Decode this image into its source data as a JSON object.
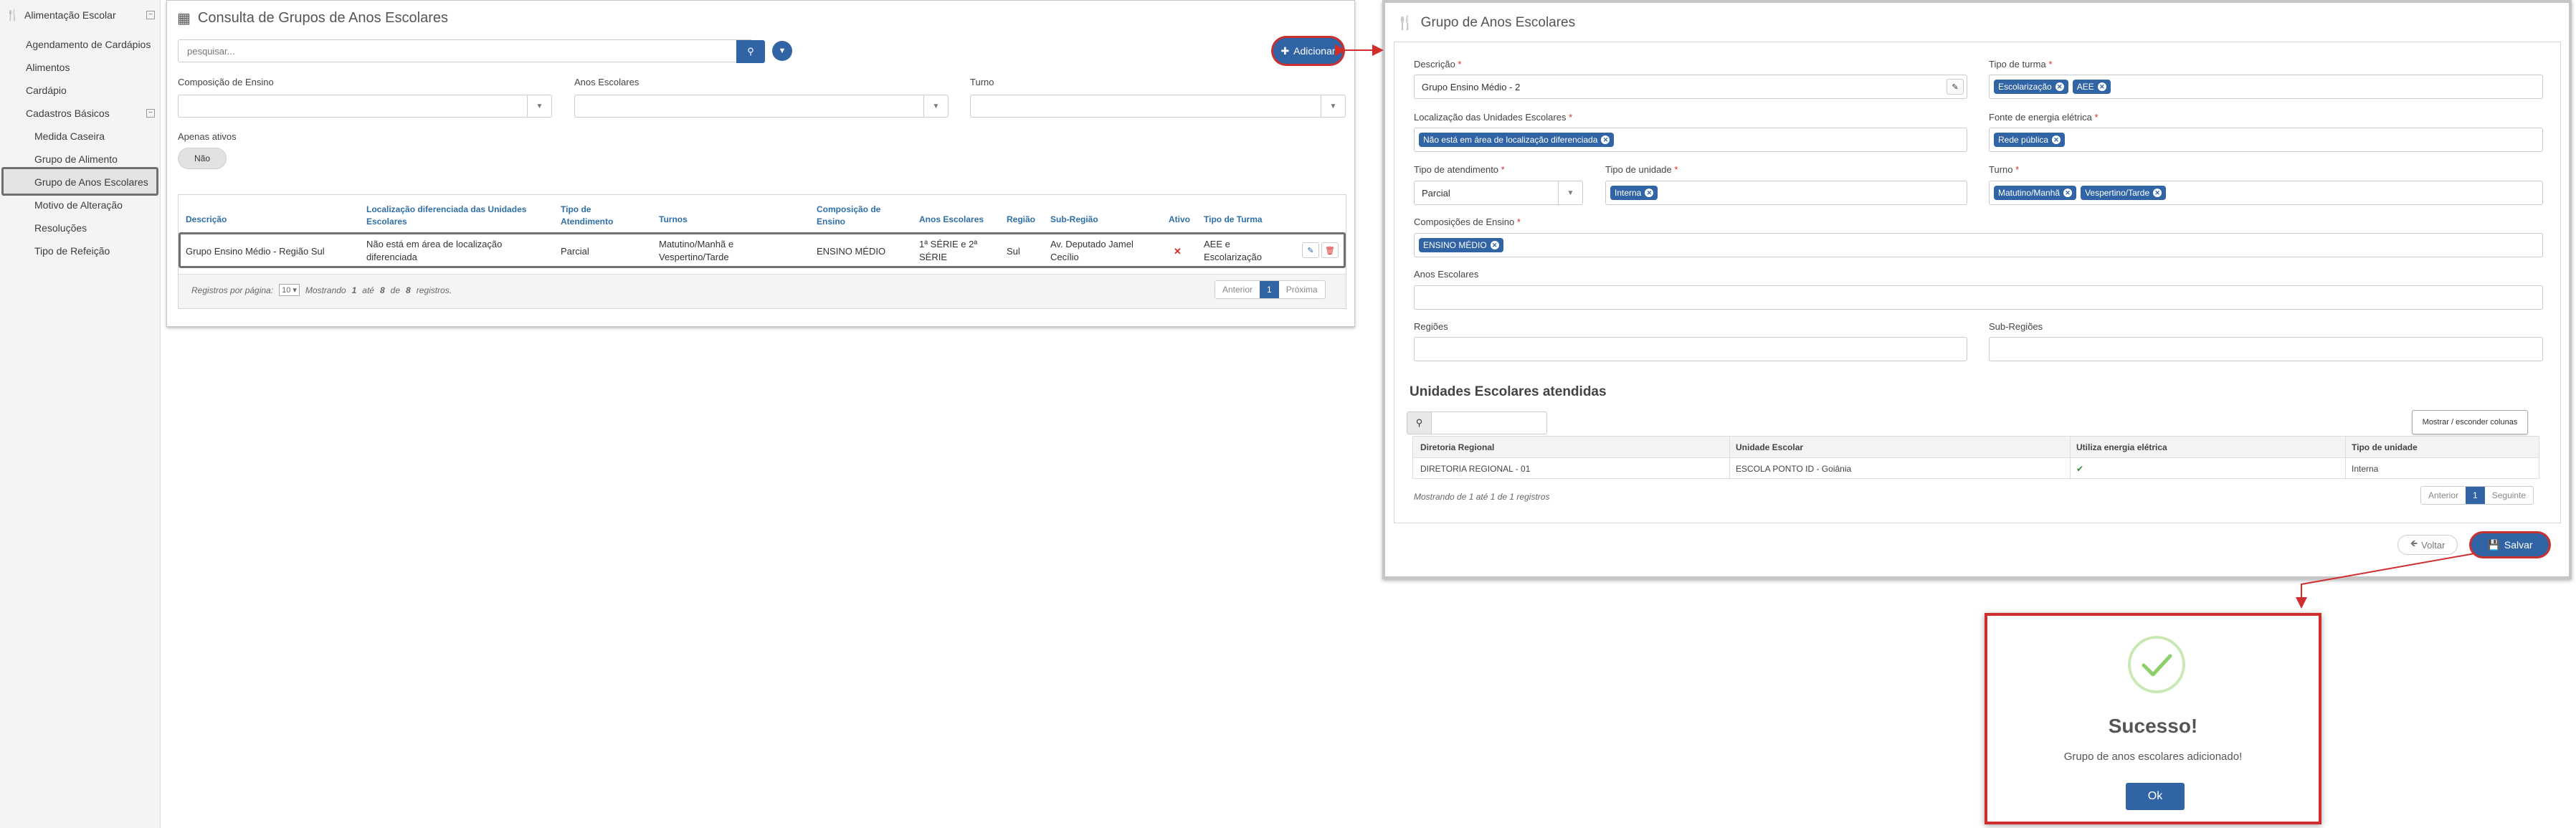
{
  "sidebar": {
    "title": "Alimentação Escolar",
    "items": [
      "Agendamento de Cardápios",
      "Alimentos",
      "Cardápio"
    ],
    "group": "Cadastros Básicos",
    "subitems": [
      "Medida Caseira",
      "Grupo de Alimento",
      "Grupo de Anos Escolares",
      "Motivo de Alteração",
      "Resoluções",
      "Tipo de Refeição"
    ]
  },
  "list_panel": {
    "title": "Consulta de Grupos de Anos Escolares",
    "search_placeholder": "pesquisar...",
    "add_label": "Adicionar",
    "filters": {
      "composicao": "Composição de Ensino",
      "anos": "Anos Escolares",
      "turno": "Turno",
      "apenas_ativos": "Apenas ativos",
      "apenas_ativos_value": "Não"
    },
    "columns": [
      "Descrição",
      "Localização diferenciada das Unidades Escolares",
      "Tipo de Atendimento",
      "Turnos",
      "Composição de Ensino",
      "Anos Escolares",
      "Região",
      "Sub-Região",
      "Ativo",
      "Tipo de Turma"
    ],
    "row": [
      "Grupo Ensino Médio - Região Sul",
      "Não está em área de localização diferenciada",
      "Parcial",
      "Matutino/Manhã e Vespertino/Tarde",
      "ENSINO MÉDIO",
      "1ª SÉRIE e 2ª SÉRIE",
      "Sul",
      "Av. Deputado Jamel Cecílio",
      "✕",
      "AEE e Escolarização"
    ],
    "footer": {
      "per_page_label": "Registros por página:",
      "per_page": "10",
      "showing_pre": "Mostrando",
      "from": "1",
      "until": "até",
      "to": "8",
      "of": "de",
      "total": "8",
      "suffix": "registros."
    },
    "pager": {
      "prev": "Anterior",
      "page": "1",
      "next": "Próxima"
    }
  },
  "form_panel": {
    "title": "Grupo de Anos Escolares",
    "descricao_label": "Descrição",
    "descricao": "Grupo Ensino Médio - 2",
    "tipo_turma_label": "Tipo de turma",
    "tipo_turma": [
      "Escolarização",
      "AEE"
    ],
    "localizacao_label": "Localização das Unidades Escolares",
    "localizacao": [
      "Não está em área de localização diferenciada"
    ],
    "fonte_label": "Fonte de energia elétrica",
    "fonte": [
      "Rede pública"
    ],
    "atendimento_label": "Tipo de atendimento",
    "atendimento": "Parcial",
    "tipo_unidade_label": "Tipo de unidade",
    "tipo_unidade": [
      "Interna"
    ],
    "turno_label": "Turno",
    "turno": [
      "Matutino/Manhã",
      "Vespertino/Tarde"
    ],
    "composicoes_label": "Composições de Ensino",
    "composicoes": [
      "ENSINO MÉDIO"
    ],
    "anos_label": "Anos Escolares",
    "regioes_label": "Regiões",
    "subregioes_label": "Sub-Regiões",
    "section_title": "Unidades Escolares atendidas",
    "cols_button": "Mostrar / esconder colunas",
    "table_headers": [
      "Diretoria Regional",
      "Unidade Escolar",
      "Utiliza energia elétrica",
      "Tipo de unidade"
    ],
    "table_row": [
      "DIRETORIA REGIONAL - 01",
      "ESCOLA PONTO ID - Goiânia",
      "✔",
      "Interna"
    ],
    "info": "Mostrando de 1 até 1 de 1 registros",
    "pager": {
      "prev": "Anterior",
      "page": "1",
      "next": "Seguinte"
    },
    "voltar": "Voltar",
    "salvar": "Salvar"
  },
  "modal": {
    "title": "Sucesso!",
    "message": "Grupo de anos escolares adicionado!",
    "ok": "Ok"
  },
  "colors": {
    "primary": "#3064a5",
    "highlight": "#c93030",
    "success": "#8dcf6a"
  }
}
